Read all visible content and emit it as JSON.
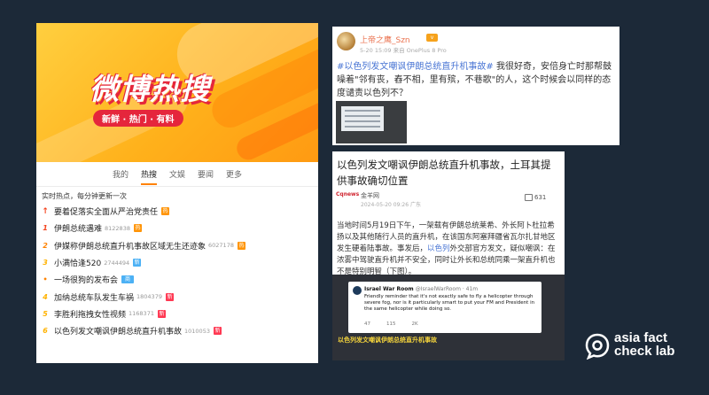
{
  "left_panel": {
    "banner": {
      "title": "微博热搜",
      "subtitle": "新鲜 · 热门 · 有料"
    },
    "tabs": [
      {
        "label": "我的",
        "active": false
      },
      {
        "label": "热搜",
        "active": true
      },
      {
        "label": "文娱",
        "active": false
      },
      {
        "label": "要闻",
        "active": false
      },
      {
        "label": "更多",
        "active": false
      }
    ],
    "realtime_note": "实时热点，每分钟更新一次",
    "hot_list": [
      {
        "rank": "pin",
        "text": "要着促落实全面从严治党责任",
        "count": "",
        "tag": "hot"
      },
      {
        "rank": "1",
        "text": "伊朗总统遇难",
        "count": "8122838",
        "tag": "hot"
      },
      {
        "rank": "2",
        "text": "伊媒称伊朗总统直升机事故区域无生还迹象",
        "count": "6027178",
        "tag": "hot"
      },
      {
        "rank": "3",
        "text": "小满恰逢520",
        "count": "2744494",
        "tag": "blue"
      },
      {
        "rank": "dot",
        "text": "一场很狗的发布会",
        "count": "",
        "tag": "ad"
      },
      {
        "rank": "4",
        "text": "加纳总统车队发生车祸",
        "count": "1804379",
        "tag": "new"
      },
      {
        "rank": "5",
        "text": "李胜利拖拽女性视频",
        "count": "1168371",
        "tag": "new"
      },
      {
        "rank": "6",
        "text": "以色列发文嘲讽伊朗总统直升机事故",
        "count": "1010053",
        "tag": "new"
      }
    ]
  },
  "post1": {
    "username": "上帝之鹰_Szn",
    "vip": "v",
    "meta": "5-20 15:09 来自 OnePlus 8 Pro",
    "topic": "#以色列发文嘲讽伊朗总统直升机事故#",
    "text": " 我很好奇，安倍身亡时那帮鼓噪着\"邻有丧，舂不相，里有殡，不巷歌\"的人，这个时候会以同样的态度谴责以色列不？"
  },
  "post2": {
    "title": "以色列发文嘲讽伊朗总统直升机事故，土耳其提供事故确切位置",
    "source_logo": "Cqnews",
    "source": "金羊网",
    "date": "2024-05-20 09:26 广东",
    "comment_count": "631",
    "body_1": "当地时间5月19日下午，一架载有伊朗总统莱希、外长阿卜杜拉希扬以及其他随行人员的直升机，在该国东阿塞拜疆省瓦尔扎甘地区发生硬着陆事故。事发后，",
    "body_link": "以色列",
    "body_2": "外交部官方发文，疑似嘲讽：在浓雾中驾驶直升机并不安全，同时让外长和总统同乘一架直升机也不是特别明智（下图）。",
    "tweet": {
      "name": "Israel War Room",
      "handle": "@IsraelWarRoom · 41m",
      "text": "Friendly reminder that it's not exactly safe to fly a helicopter through severe fog, nor is it particularly smart to put your FM and President in the same helicopter while doing so.",
      "actions": [
        "47",
        "115",
        "2K"
      ]
    },
    "video_caption": "以色列发文嘲讽伊朗总统直升机事故",
    "video_sub": ""
  },
  "watermark": {
    "line1": "asia fact",
    "line2": "check lab"
  },
  "colors": {
    "background": "#1c2938",
    "weibo_orange": "#ff8200",
    "link_blue": "#4a76d4",
    "rank_red": "#f4421d"
  }
}
